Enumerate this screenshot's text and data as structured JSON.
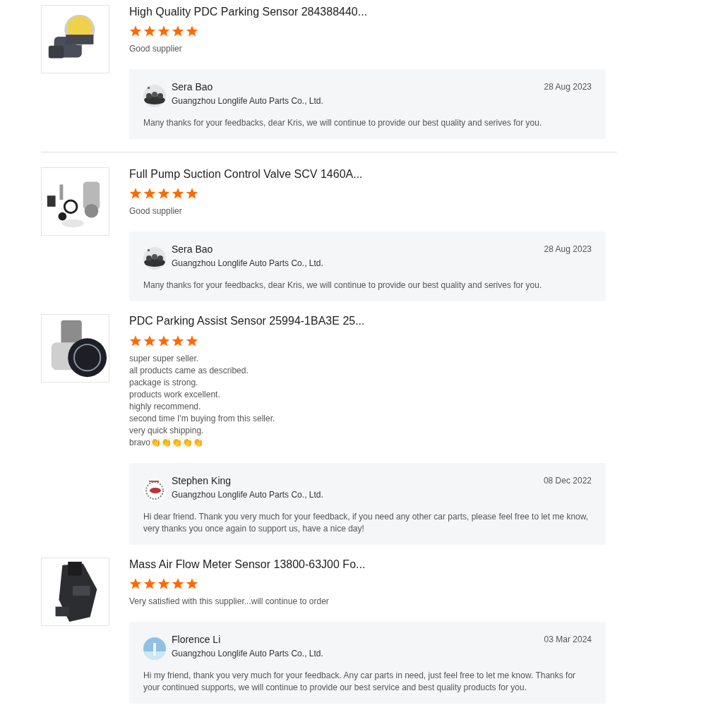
{
  "reviews": [
    {
      "product": {
        "title": "High Quality PDC Parking Sensor 284388440...",
        "kind": "picture"
      },
      "stars": 5,
      "comment": [
        "Good supplier"
      ],
      "reply": {
        "name": "Sera Bao",
        "company": "Guangzhou Longlife Auto Parts Co., Ltd.",
        "date": "28 Aug 2023",
        "message": "Many thanks for your feedbacks, dear Kris, we will continue to provide our best quality and serives for you."
      },
      "divider_below": true
    },
    {
      "product": {
        "title": "Full Pump Suction Control Valve SCV 1460A...",
        "kind": "picture"
      },
      "stars": 5,
      "comment": [
        "Good supplier"
      ],
      "reply": {
        "name": "Sera Bao",
        "company": "Guangzhou Longlife Auto Parts Co., Ltd.",
        "date": "28 Aug 2023",
        "message": "Many thanks for your feedbacks, dear Kris, we will continue to provide our best quality and serives for you."
      },
      "divider_below": false
    },
    {
      "product": {
        "title": "PDC Parking Assist Sensor 25994-1BA3E 25...",
        "kind": "picture"
      },
      "stars": 5,
      "comment": [
        "super super seller.",
        "all products came as described.",
        "package is strong.",
        "products work excellent.",
        "highly recommend.",
        "second time I'm buying from this seller.",
        "very quick shipping.",
        "bravo👏👏👏👏👏"
      ],
      "reply": {
        "name": "Stephen King",
        "company": "Guangzhou Longlife Auto Parts Co., Ltd.",
        "date": "08 Dec 2022",
        "message": "Hi dear friend. Thank you very much for your feedback,  if you need any other car parts, please feel free to let me know, very thanks you once again to support us, have a nice day!"
      },
      "divider_below": false
    },
    {
      "product": {
        "title": "Mass Air Flow Meter Sensor 13800-63J00 Fo...",
        "kind": "picture"
      },
      "stars": 5,
      "comment": [
        "Very satisfied with this supplier...will continue to order"
      ],
      "reply": {
        "name": "Florence Li",
        "company": "Guangzhou Longlife Auto Parts Co., Ltd.",
        "date": "03 Mar 2024",
        "message": "Hi my friend, thank you very much for your feedback. Any car parts in need, just feel free to let me know. Thanks for your continued supports, we will continue to provide our best service and best quality products for you."
      },
      "divider_below": false
    }
  ]
}
